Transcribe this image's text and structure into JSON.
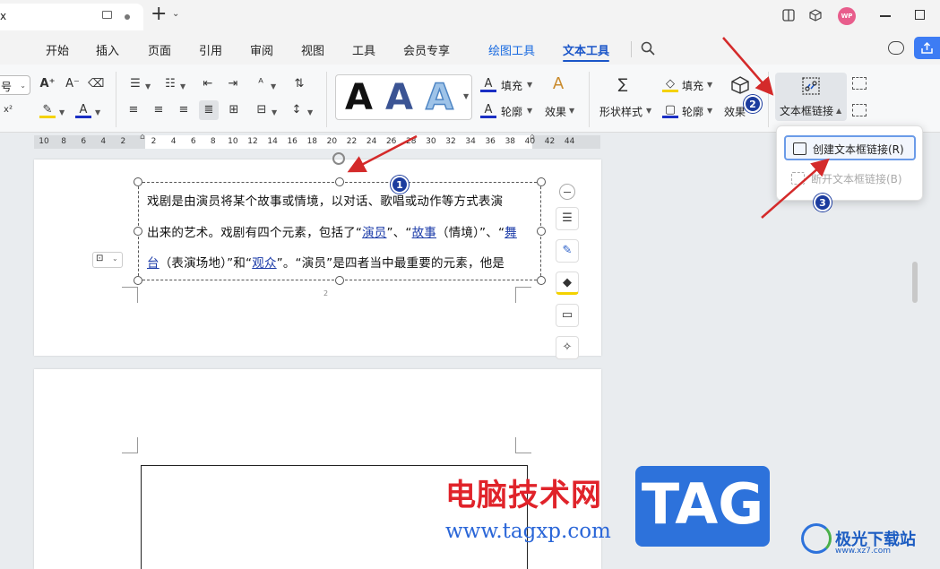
{
  "titlebar": {
    "doc_title": "x",
    "avatar": "WP"
  },
  "menu": {
    "items": [
      "开始",
      "插入",
      "页面",
      "引用",
      "审阅",
      "视图",
      "工具",
      "会员专享"
    ],
    "drawing_tools": "绘图工具",
    "text_tools": "文本工具"
  },
  "ribbon": {
    "font_size_tail": "号",
    "fill": "填充",
    "outline": "轮廓",
    "effect": "效果",
    "shape_style": "形状样式",
    "fill2": "填充",
    "outline2": "轮廓",
    "effect2": "效果",
    "textbox_link": "文本框链接"
  },
  "dropdown": {
    "create_link": "创建文本框链接(R)",
    "break_link": "断开文本框链接(B)"
  },
  "ruler": {
    "ticks": [
      "10",
      "8",
      "6",
      "4",
      "2",
      "2",
      "4",
      "6",
      "8",
      "10",
      "12",
      "14",
      "16",
      "18",
      "20",
      "22",
      "24",
      "26",
      "28",
      "30",
      "32",
      "34",
      "36",
      "38",
      "40",
      "42",
      "44"
    ]
  },
  "textbox": {
    "line1": "戏剧是由演员将某个故事或情境，以对话、歌唱或动作等方式表演",
    "line2_a": "出来的艺术。戏剧有四个元素，包括了“",
    "line2_link1": "演员",
    "line2_b": "”、“",
    "line2_link2": "故事",
    "line2_c": "（情境）”、“",
    "line2_link3": "舞",
    "line3_link3": "台",
    "line3_a": "（表演场地）”和“",
    "line3_link4": "观众",
    "line3_b": "”。“演员”是四者当中最重要的元素，他是"
  },
  "page_number": "2",
  "annotations": {
    "badge1": "1",
    "badge2": "2",
    "badge3": "3"
  },
  "watermark": {
    "site_name": "电脑技术网",
    "url": "www.tagxp.com",
    "tag": "TAG",
    "logo_text": "极光下载站",
    "logo_sub": "www.xz7.com"
  },
  "colors": {
    "accent": "#1a55c8",
    "arrow": "#d42a2a",
    "badge": "#1c3c9e"
  }
}
